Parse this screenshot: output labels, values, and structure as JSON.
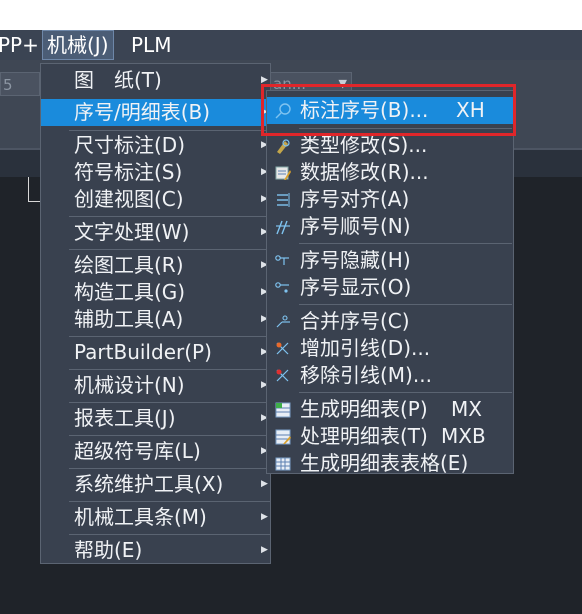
{
  "menubar": {
    "app_label": "PP+",
    "mechanical_label": "机械(J)",
    "plm_label": "PLM"
  },
  "toolbar": {
    "combo1_value": "5",
    "combo2_value": "an..."
  },
  "main_menu": {
    "items": [
      {
        "label": "图　纸(T)"
      },
      {
        "label": "序号/明细表(B)"
      },
      {
        "label": "尺寸标注(D)"
      },
      {
        "label": "符号标注(S)"
      },
      {
        "label": "创建视图(C)"
      },
      {
        "label": "文字处理(W)"
      },
      {
        "label": "绘图工具(R)"
      },
      {
        "label": "构造工具(G)"
      },
      {
        "label": "辅助工具(A)"
      },
      {
        "label": "PartBuilder(P)"
      },
      {
        "label": "机械设计(N)"
      },
      {
        "label": "报表工具(J)"
      },
      {
        "label": "超级符号库(L)"
      },
      {
        "label": "系统维护工具(X)"
      },
      {
        "label": "机械工具条(M)"
      },
      {
        "label": "帮助(E)"
      }
    ]
  },
  "sub_menu": {
    "items": [
      {
        "label": "标注序号(B)...",
        "shortcut": "XH",
        "icon": "balloon-icon"
      },
      {
        "label": "类型修改(S)...",
        "icon": "type-edit-icon"
      },
      {
        "label": "数据修改(R)...",
        "icon": "data-edit-icon"
      },
      {
        "label": "序号对齐(A)",
        "icon": "align-icon"
      },
      {
        "label": "序号顺号(N)",
        "icon": "renumber-icon"
      },
      {
        "label": "序号隐藏(H)",
        "icon": "hide-icon"
      },
      {
        "label": "序号显示(O)",
        "icon": "show-icon"
      },
      {
        "label": "合并序号(C)",
        "icon": "merge-icon"
      },
      {
        "label": "增加引线(D)...",
        "icon": "add-leader-icon"
      },
      {
        "label": "移除引线(M)...",
        "icon": "remove-leader-icon"
      },
      {
        "label": "生成明细表(P)",
        "shortcut": "MX",
        "icon": "generate-bom-icon"
      },
      {
        "label": "处理明细表(T)",
        "shortcut": "MXB",
        "icon": "process-bom-icon"
      },
      {
        "label": "生成明细表表格(E)",
        "icon": "bom-table-icon"
      }
    ]
  }
}
